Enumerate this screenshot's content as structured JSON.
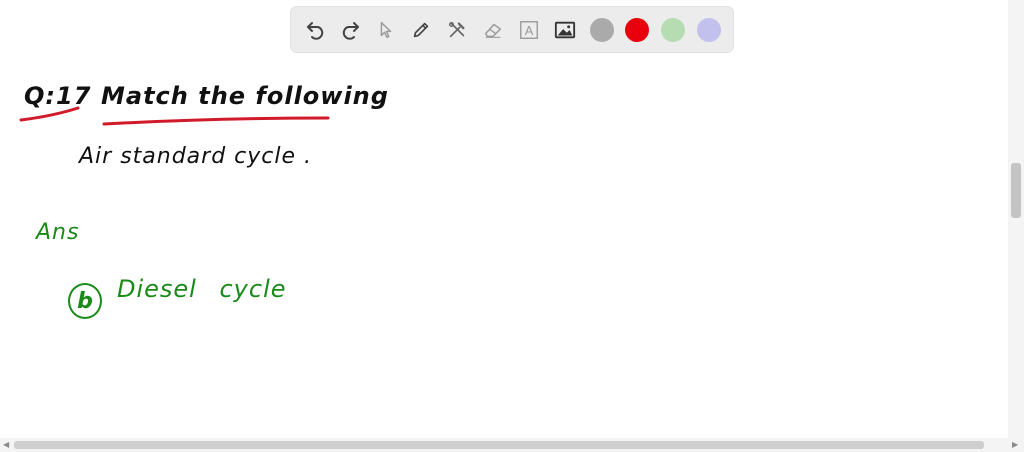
{
  "toolbar": {
    "tools": [
      {
        "name": "undo",
        "icon": "undo-icon"
      },
      {
        "name": "redo",
        "icon": "redo-icon"
      },
      {
        "name": "select",
        "icon": "cursor-icon"
      },
      {
        "name": "pen",
        "icon": "pencil-icon"
      },
      {
        "name": "tools",
        "icon": "tools-icon"
      },
      {
        "name": "eraser",
        "icon": "eraser-icon"
      },
      {
        "name": "text",
        "icon": "text-box-icon",
        "glyph": "A"
      },
      {
        "name": "image",
        "icon": "image-icon"
      }
    ],
    "colors": [
      {
        "name": "gray",
        "hex": "#aaaaaa"
      },
      {
        "name": "red",
        "hex": "#e8000c"
      },
      {
        "name": "green",
        "hex": "#b6ddb2"
      },
      {
        "name": "lavender",
        "hex": "#c2c1ee"
      }
    ]
  },
  "canvas": {
    "question_number": "Q:17",
    "question_title": "Match the following",
    "topic": "Air standard cycle .",
    "answer_label": "Ans",
    "answer_option": "b",
    "answer_text": "Diesel cycle",
    "ink_black": "#111111",
    "ink_red": "#d11a2a",
    "ink_green": "#1a8a1a"
  }
}
